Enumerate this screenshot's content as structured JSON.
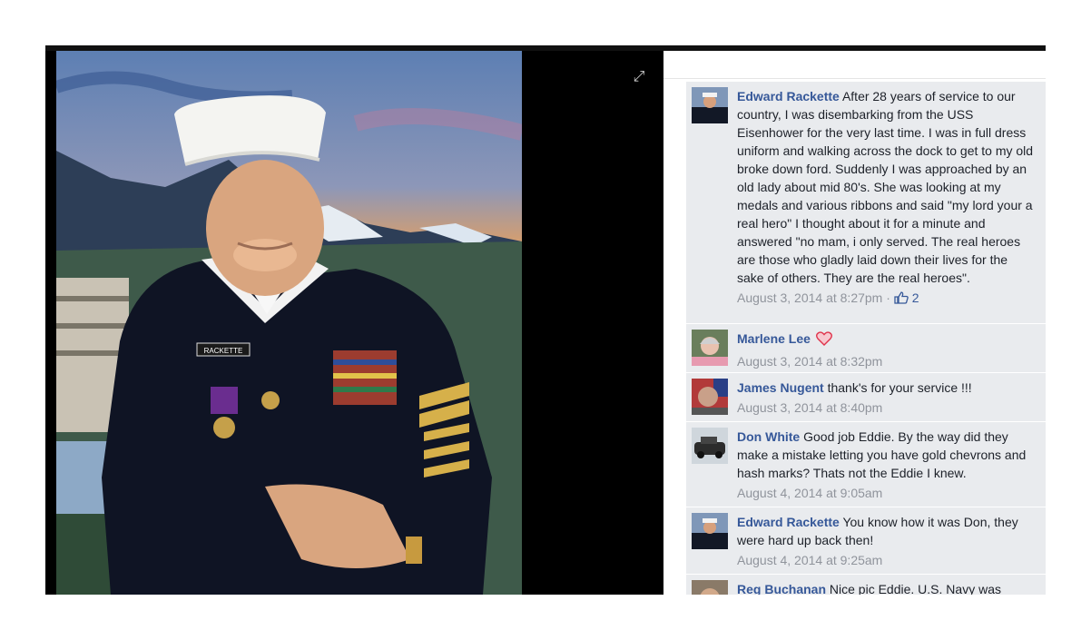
{
  "viewer": {
    "expand_icon": "expand-icon"
  },
  "comments": [
    {
      "author": "Edward Rackette",
      "text": " After 28 years of service to our country, I was disembarking from the USS Eisenhower for the very last time. I was in full dress uniform and walking across the dock to get to my old broke down ford. Suddenly I was approached by an old lady about mid 80's. She was looking at my medals and various ribbons and said \"my lord your a real hero\" I thought about it for a minute and answered \"no mam, i only served. The real heroes are those who gladly laid down their lives for the sake of others. They are the real heroes\".",
      "timestamp": "August 3, 2014 at 8:27pm",
      "separator": " · ",
      "likes": "2"
    },
    {
      "author": "Marlene Lee",
      "text": "",
      "reaction": "heart-icon",
      "timestamp": "August 3, 2014 at 8:32pm"
    },
    {
      "author": "James Nugent",
      "text": " thank's for your service !!!",
      "timestamp": "August 3, 2014 at 8:40pm"
    },
    {
      "author": "Don White",
      "text": " Good job Eddie. By the way did they make a mistake letting you have gold chevrons and hash marks? Thats not the Eddie I knew.",
      "timestamp": "August 4, 2014 at 9:05am"
    },
    {
      "author": "Edward Rackette",
      "text": " You know how it was Don, they were hard up back then!",
      "timestamp": "August 4, 2014 at 9:25am"
    },
    {
      "author": "Reg Buchanan",
      "text": " Nice pic Eddie. U.S. Navy was"
    }
  ],
  "photo": {
    "nametag": "RACKETTE"
  },
  "colors": {
    "link": "#365899",
    "meta": "#90949c",
    "comment_bg": "#e9ebee",
    "heart": "#e0334b"
  }
}
